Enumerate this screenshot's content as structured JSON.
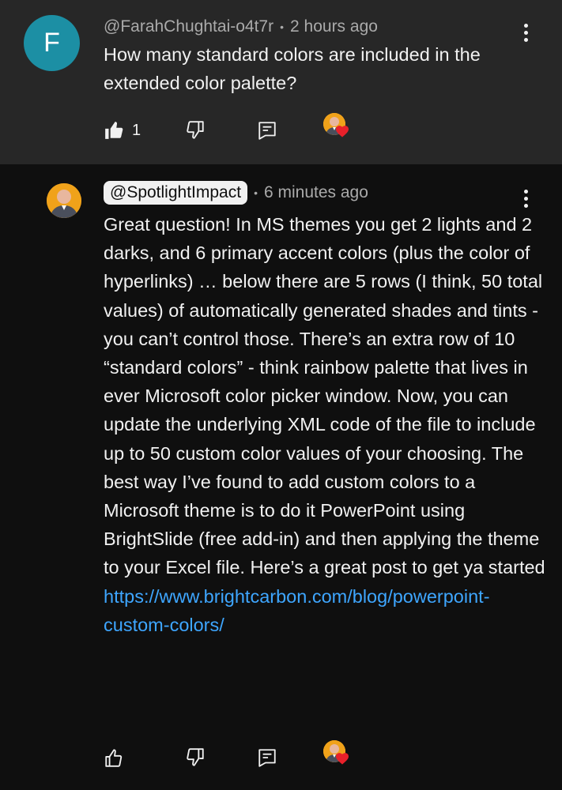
{
  "top_comment": {
    "avatar_letter": "F",
    "author": "@FarahChughtai-o4t7r",
    "separator": "•",
    "time": "2 hours ago",
    "text": "How many standard colors are included in the extended color palette?",
    "like_count": "1",
    "icons": {
      "like": "thumbs-up-filled-icon",
      "dislike": "thumbs-down-icon",
      "reply": "reply-icon",
      "creator_heart": "creator-heart-icon",
      "more": "more-vertical-icon"
    }
  },
  "reply_comment": {
    "author": "@SpotlightImpact",
    "separator": "•",
    "time": "6 minutes ago",
    "text": "Great question! In MS themes you get 2 lights and 2 darks, and  6 primary accent colors (plus the color of hyperlinks) … below there are 5 rows (I think, 50 total values) of automatically generated shades and tints - you can’t control those. There’s an extra row of 10 “standard colors” - think rainbow palette that lives in ever Microsoft color picker window. Now, you can update the underlying XML code of the file to include up to 50 custom color values of your choosing. The best way I’ve found to add custom colors to a Microsoft theme is to do it PowerPoint using BrightSlide (free add-in) and then applying the theme to your Excel file. Here’s a great post to get ya started ",
    "link": "https://www.brightcarbon.com/blog/powerpoint-custom-colors/",
    "icons": {
      "like": "thumbs-up-icon",
      "dislike": "thumbs-down-icon",
      "reply": "reply-icon",
      "creator_heart": "creator-heart-icon",
      "more": "more-vertical-icon"
    }
  },
  "colors": {
    "background": "#0f0f0f",
    "highlighted_background": "#272727",
    "avatar_letter_bg": "#1c8fa4",
    "link": "#3ea6ff",
    "heart": "#e8202a",
    "secondary_text": "#aaaaaa"
  }
}
